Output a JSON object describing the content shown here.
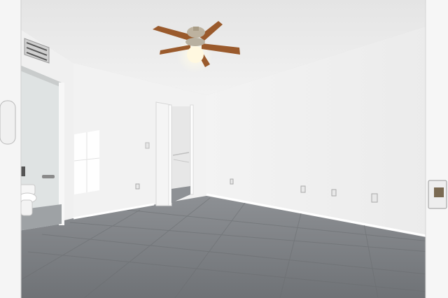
{
  "scene": {
    "kind": "photo",
    "subject": "empty room",
    "elements": [
      "ceiling-fan",
      "ceiling-light",
      "air-vent",
      "open-bathroom-door",
      "toilet",
      "closet-door",
      "window-light-reflection",
      "tiled-floor",
      "electrical-outlets",
      "open-entry-door"
    ]
  },
  "colors": {
    "wall": "#f1f1f1",
    "wall_right": "#eeeeee",
    "ceiling": "#ececec",
    "floor": "#7a7d80",
    "fan_blade": "#9a5a2c",
    "fan_metal": "#b8b0a0",
    "light": "#fff8e0",
    "door": "#f4f4f4"
  }
}
